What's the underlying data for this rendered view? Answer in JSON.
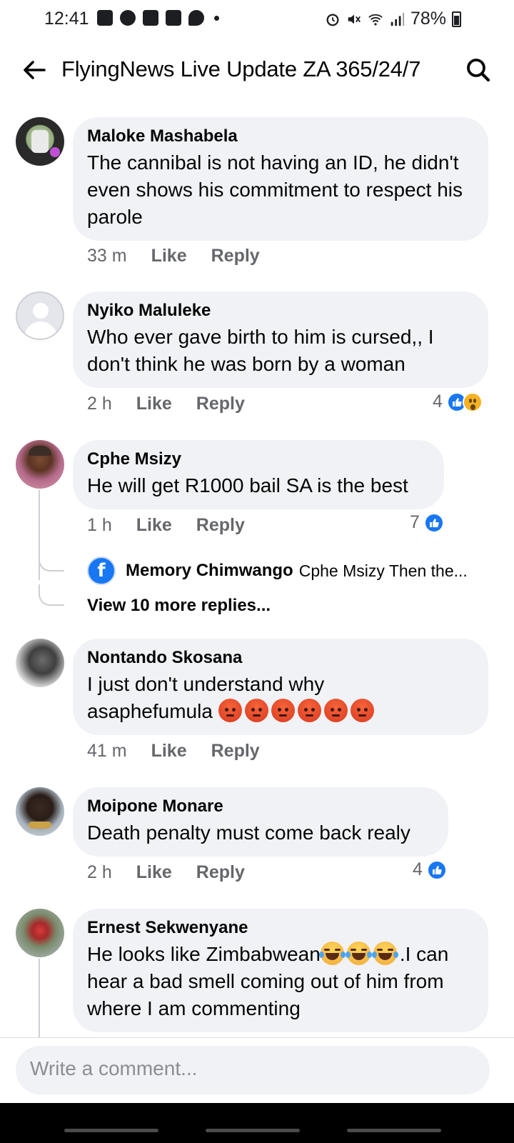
{
  "status_bar": {
    "time": "12:41",
    "battery": "78%",
    "left_icons": [
      "message-icon",
      "facebook-icon",
      "download-icon",
      "teams-icon",
      "twitter-icon",
      "dot-icon"
    ],
    "right_icons": [
      "alarm-icon",
      "mute-icon",
      "wifi-icon",
      "signal-icon",
      "battery-icon"
    ]
  },
  "header": {
    "title": "FlyingNews Live Update ZA 365/24/7"
  },
  "actions": {
    "like": "Like",
    "reply": "Reply"
  },
  "comments": [
    {
      "author": "Maloke Mashabela",
      "text": "The cannibal is not having an ID, he didn't even shows his commitment to respect his  parole",
      "time": "33 m",
      "reactions": null
    },
    {
      "author": "Nyiko Maluleke",
      "text": "Who ever gave birth to him is cursed,, I don't think he was born by a woman",
      "time": "2 h",
      "reactions": {
        "count": "4",
        "types": [
          "like",
          "wow"
        ]
      }
    },
    {
      "author": "Cphe Msizy",
      "text": "He will get R1000 bail SA is the best",
      "time": "1 h",
      "reactions": {
        "count": "7",
        "types": [
          "like"
        ]
      },
      "reply_preview": {
        "author": "Memory Chimwango",
        "snippet": "Cphe Msizy  Then the..."
      },
      "view_more": "View 10 more replies..."
    },
    {
      "author": "Nontando Skosana",
      "text": "I just don't understand why asaphefumula",
      "emojis": [
        "angry",
        "angry",
        "angry",
        "angry",
        "angry",
        "angry"
      ],
      "time": "41 m",
      "reactions": null
    },
    {
      "author": "Moipone Monare",
      "text": "Death penalty must come back realy",
      "time": "2 h",
      "reactions": {
        "count": "4",
        "types": [
          "like"
        ]
      }
    },
    {
      "author": "Ernest Sekwenyane",
      "text_before": "He looks like Zimbabwean",
      "emojis": [
        "laughing",
        "laughing",
        "laughing"
      ],
      "text_after": ".I can hear a bad smell coming out of him from where I am commenting"
    }
  ],
  "composer": {
    "placeholder": "Write a comment..."
  },
  "colors": {
    "bubble": "#f0f2f5",
    "meta_text": "#65676b",
    "like_blue": "#1877f2"
  }
}
